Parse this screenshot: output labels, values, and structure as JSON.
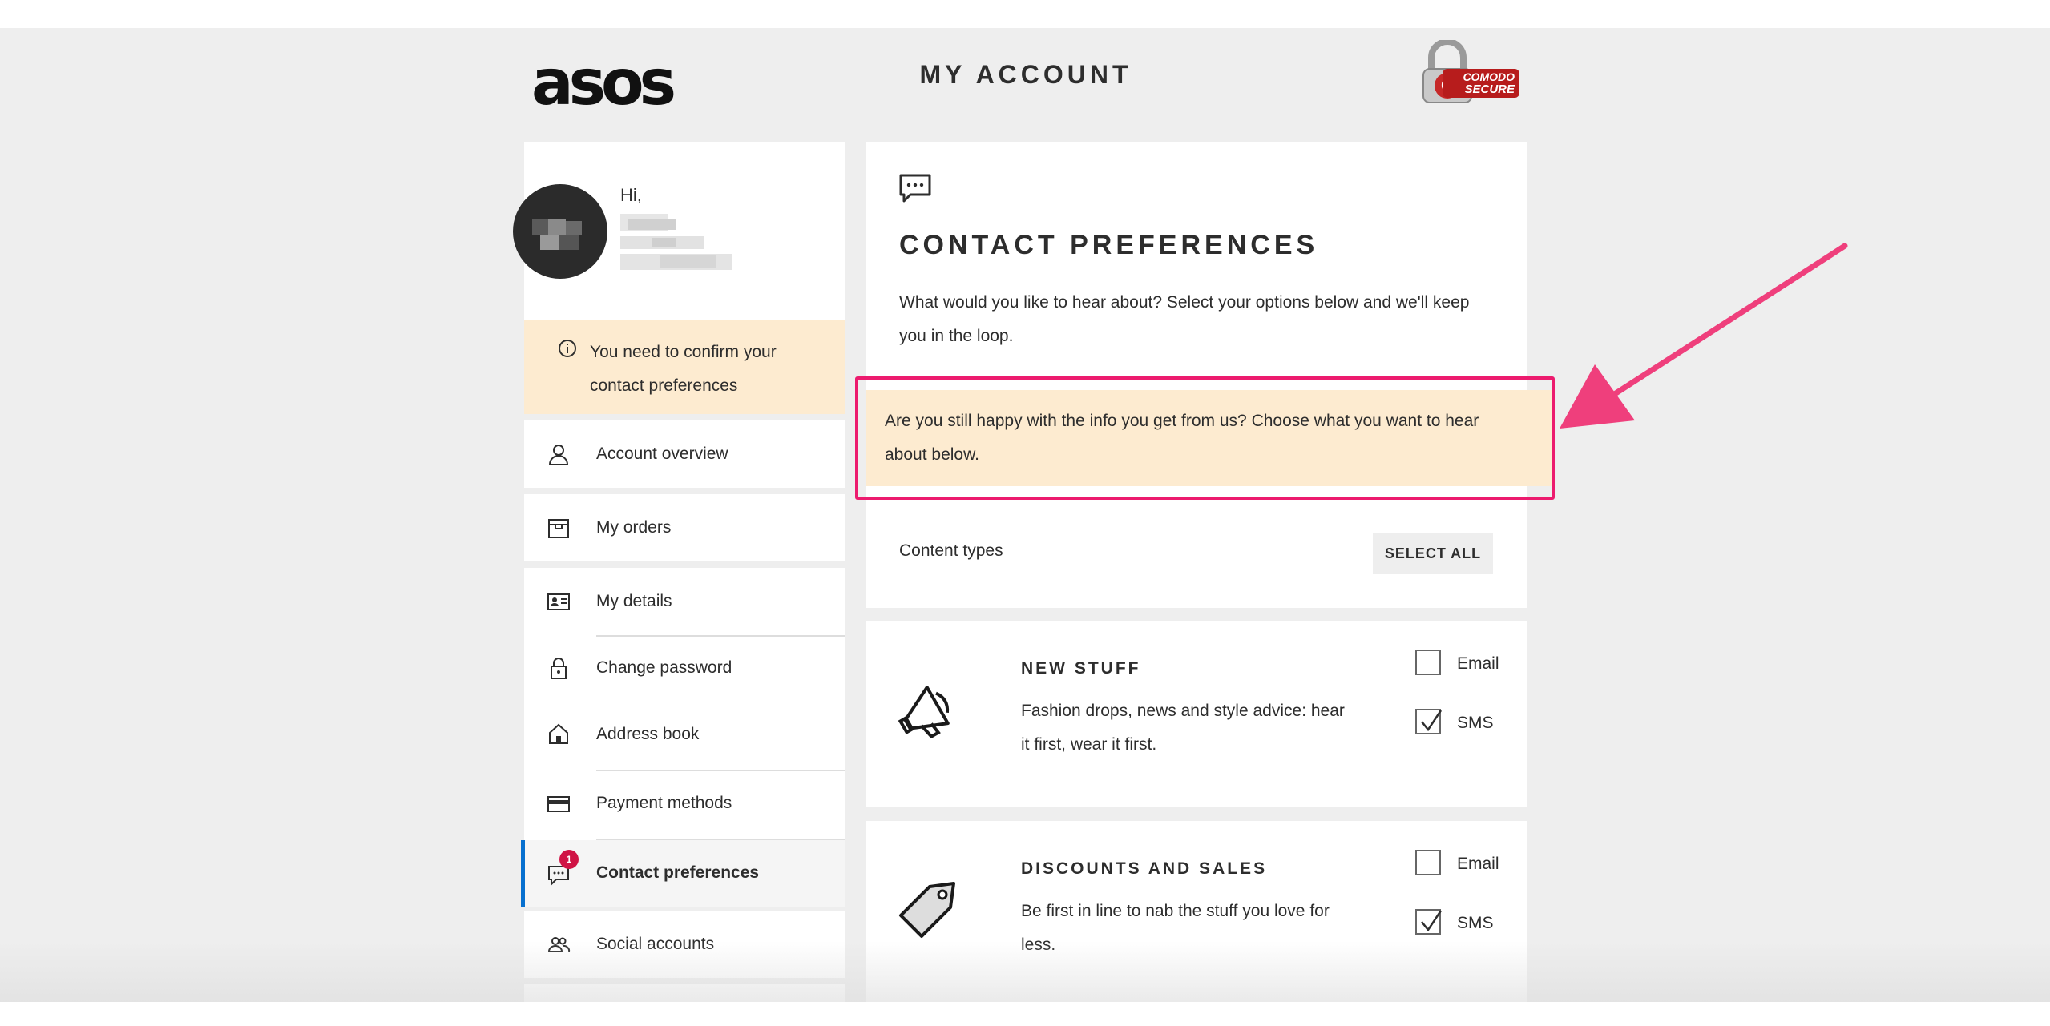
{
  "header": {
    "logo": "asos",
    "title": "MY ACCOUNT",
    "secure_badge": {
      "line1": "COMODO",
      "line2": "SECURE",
      "color": "#b71c1c"
    }
  },
  "profile": {
    "greeting": "Hi,"
  },
  "sidebar": {
    "notice_icon": "info-icon",
    "notice": "You need to confirm your contact preferences",
    "items": [
      {
        "label": "Account overview",
        "icon": "person-icon"
      },
      {
        "label": "My orders",
        "icon": "box-icon"
      },
      {
        "label": "My details",
        "icon": "id-card-icon"
      },
      {
        "label": "Change password",
        "icon": "lock-icon"
      },
      {
        "label": "Address book",
        "icon": "house-icon"
      },
      {
        "label": "Payment methods",
        "icon": "card-icon"
      },
      {
        "label": "Contact preferences",
        "icon": "chat-icon",
        "active": true,
        "badge": "1"
      },
      {
        "label": "Social accounts",
        "icon": "people-icon"
      }
    ]
  },
  "main": {
    "icon": "chat-bubble-icon",
    "title": "CONTACT PREFERENCES",
    "intro": "What would you like to hear about? Select your options below and we'll keep you in the loop.",
    "banner": "Are you still happy with the info you get from us? Choose what you want to hear about below.",
    "content_types_label": "Content types",
    "select_all_label": "SELECT ALL",
    "preferences": [
      {
        "title": "NEW STUFF",
        "description": "Fashion drops, news and style advice: hear it first, wear it first.",
        "icon": "megaphone-icon",
        "email_label": "Email",
        "email_checked": false,
        "sms_label": "SMS",
        "sms_checked": true
      },
      {
        "title": "DISCOUNTS AND SALES",
        "description": "Be first in line to nab the stuff you love for less.",
        "icon": "price-tag-icon",
        "email_label": "Email",
        "email_checked": false,
        "sms_label": "SMS",
        "sms_checked": true
      }
    ]
  },
  "annotation": {
    "highlight_color": "#ec1b6e",
    "arrow_color": "#ef3f7c"
  },
  "colors": {
    "background": "#eeeeee",
    "notice_bg": "#fdebd0",
    "active_bar": "#0770cf",
    "badge": "#d01345"
  }
}
